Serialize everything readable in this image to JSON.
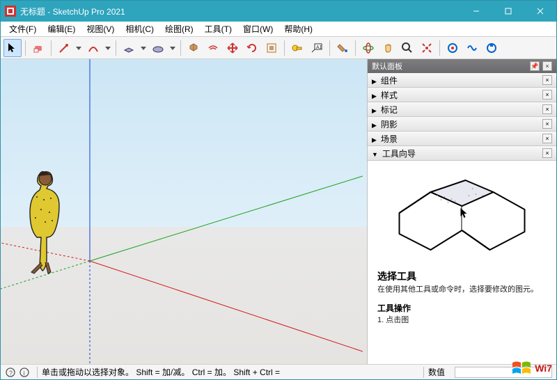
{
  "title": "无标题 - SketchUp Pro 2021",
  "menu": {
    "file": "文件(F)",
    "edit": "编辑(E)",
    "view": "视图(V)",
    "camera": "相机(C)",
    "draw": "绘图(R)",
    "tools": "工具(T)",
    "window": "窗口(W)",
    "help": "帮助(H)"
  },
  "panel": {
    "title": "默认面板",
    "items": {
      "components": "组件",
      "styles": "样式",
      "tags": "标记",
      "shadows": "阴影",
      "scenes": "场景",
      "instructor": "工具向导"
    }
  },
  "instructor": {
    "heading": "选择工具",
    "desc": "在使用其他工具或命令时，选择要修改的图元。",
    "ops_heading": "工具操作",
    "ops_step": "1. 点击图"
  },
  "status": {
    "hint": "单击或拖动以选择对象。 Shift = 加/减。 Ctrl = 加。 Shift + Ctrl =",
    "value_label": "数值"
  },
  "watermark": "Wi7"
}
